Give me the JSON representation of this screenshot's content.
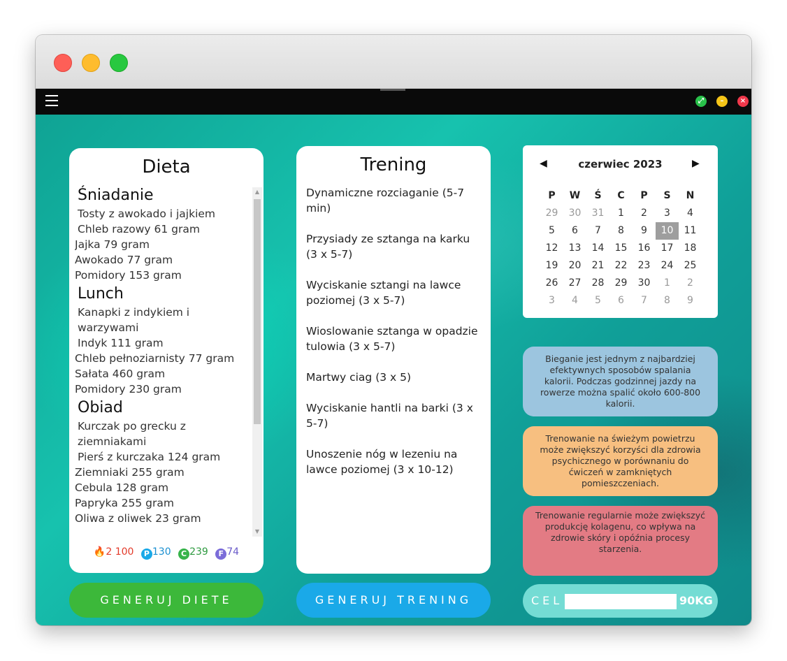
{
  "window": {
    "controls": {
      "green_symbol": "⤢",
      "yellow_symbol": "–",
      "red_symbol": "×"
    }
  },
  "diet": {
    "title": "Dieta",
    "meals": [
      {
        "title": "Śniadanie",
        "dish": "Tosty z awokado i jajkiem",
        "items": [
          "Chleb razowy 61  gram",
          "Jajka 79  gram",
          "Awokado 77  gram",
          "Pomidory 153  gram"
        ]
      },
      {
        "title": "Lunch",
        "dish": "Kanapki z indykiem i warzywami",
        "items": [
          "Indyk 111  gram",
          "Chleb pełnoziarnisty 77  gram",
          "Sałata 460  gram",
          "Pomidory 230  gram"
        ]
      },
      {
        "title": "Obiad",
        "dish": "Kurczak po grecku z ziemniakami",
        "items": [
          "Pierś z kurczaka 124  gram",
          "Ziemniaki 255  gram",
          "Cebula 128  gram",
          "Papryka 255  gram",
          "Oliwa z oliwek 23  gram"
        ]
      }
    ],
    "macros": {
      "calories": {
        "value": "2 100",
        "color": "#f04a3a",
        "icon": "flame-icon"
      },
      "protein": {
        "label": "P",
        "value": "130",
        "color": "#1aa9e8"
      },
      "carbs": {
        "label": "C",
        "value": "239",
        "color": "#36b34a"
      },
      "fat": {
        "label": "F",
        "value": "74",
        "color": "#7b6cd9"
      }
    },
    "generate_button": "GENERUJ DIETE"
  },
  "training": {
    "title": "Trening",
    "exercises": [
      "Dynamiczne rozciaganie (5-7 min)",
      "Przysiady ze sztanga na karku (3 x 5-7)",
      "Wyciskanie sztangi na lawce poziomej (3 x 5-7)",
      "Wioslowanie sztanga w opadzie tulowia (3 x 5-7)",
      "Martwy ciag (3 x 5)",
      "Wyciskanie hantli na barki (3 x 5-7)",
      "Unoszenie nóg w lezeniu na lawce poziomej (3 x 10-12)"
    ],
    "generate_button": "GENERUJ TRENING"
  },
  "calendar": {
    "month_label": "czerwiec 2023",
    "prev_symbol": "◀",
    "next_symbol": "▶",
    "weekdays": [
      "P",
      "W",
      "Ś",
      "C",
      "P",
      "S",
      "N"
    ],
    "weeks": [
      [
        "29",
        "30",
        "31",
        "1",
        "2",
        "3",
        "4"
      ],
      [
        "5",
        "6",
        "7",
        "8",
        "9",
        "10",
        "11"
      ],
      [
        "12",
        "13",
        "14",
        "15",
        "16",
        "17",
        "18"
      ],
      [
        "19",
        "20",
        "21",
        "22",
        "23",
        "24",
        "25"
      ],
      [
        "26",
        "27",
        "28",
        "29",
        "30",
        "1",
        "2"
      ],
      [
        "3",
        "4",
        "5",
        "6",
        "7",
        "8",
        "9"
      ]
    ],
    "selected_day": "10"
  },
  "tips": [
    "Bieganie jest jednym z najbardziej efektywnych sposobów spalania kalorii. Podczas godzinnej jazdy na rowerze można spalić około 600-800 kalorii.",
    "Trenowanie na świeżym powietrzu może zwiększyć korzyści dla zdrowia psychicznego w porównaniu do ćwiczeń w zamkniętych pomieszczeniach.",
    "Trenowanie regularnie może zwiększyć produkcję kolagenu, co wpływa na zdrowie skóry i opóźnia procesy starzenia."
  ],
  "goal": {
    "label": "CEL",
    "input_value": "",
    "value": "90KG"
  }
}
